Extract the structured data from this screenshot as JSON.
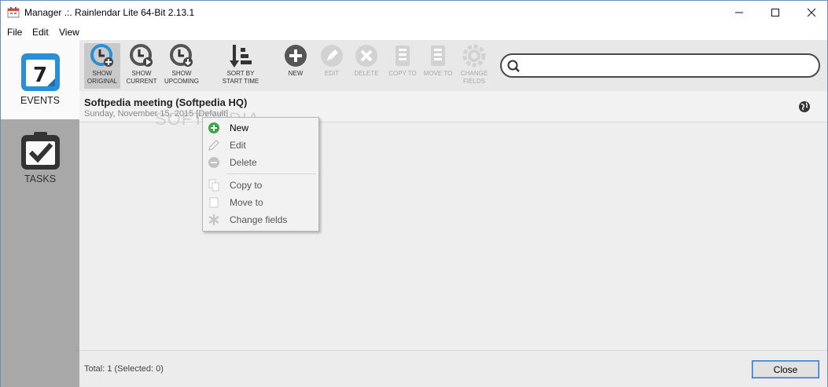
{
  "window": {
    "title": "Manager .:. Rainlendar Lite 64-Bit 2.13.1",
    "minimize": "—",
    "maximize": "☐",
    "close": "✕"
  },
  "menu": [
    "File",
    "Edit",
    "View"
  ],
  "sidebar": {
    "events_label": "EVENTS",
    "events_badge": "7",
    "tasks_label": "TASKS"
  },
  "toolbar": {
    "show_original": "SHOW\nORIGINAL",
    "show_current": "SHOW\nCURRENT",
    "show_upcoming": "SHOW\nUPCOMING",
    "sort": "SORT BY\nSTART TIME",
    "new": "NEW",
    "edit": "EDIT",
    "delete": "DELETE",
    "copy_to": "COPY TO",
    "move_to": "MOVE TO",
    "change_fields": "CHANGE\nFIELDS"
  },
  "search": {
    "value": "",
    "placeholder": ""
  },
  "event": {
    "title": "Softpedia meeting (Softpedia HQ)",
    "subtitle": "Sunday, November 15, 2015  [Default]"
  },
  "watermark": "SOFTPEDIA",
  "context_menu": {
    "items": [
      {
        "label": "New",
        "enabled": true
      },
      {
        "label": "Edit",
        "enabled": false
      },
      {
        "label": "Delete",
        "enabled": false
      },
      {
        "label": "Copy to",
        "enabled": false
      },
      {
        "label": "Move to",
        "enabled": false
      },
      {
        "label": "Change fields",
        "enabled": false
      }
    ]
  },
  "status": {
    "total": "Total: 1 (Selected: 0)",
    "close_button": "Close"
  },
  "colors": {
    "accent_blue": "#2b8fd6",
    "sidebar_gray": "#a8a8a8",
    "new_green": "#3aa84a"
  }
}
